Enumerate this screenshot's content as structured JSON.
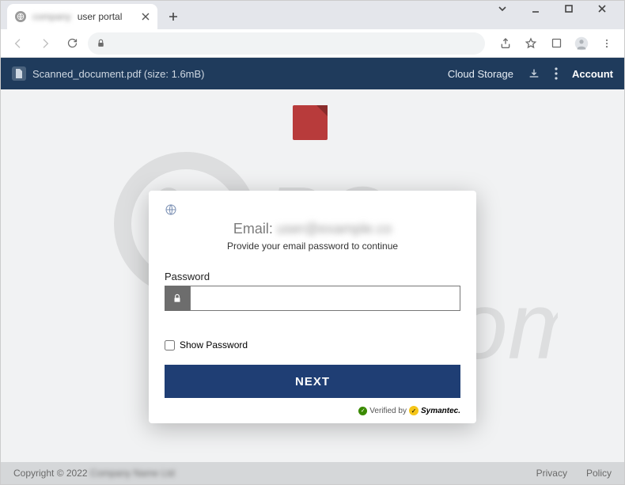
{
  "browser": {
    "tab_title_blur": "company",
    "tab_title_suffix": "user portal"
  },
  "appbar": {
    "file_label": "Scanned_document.pdf (size: 1.6mB)",
    "cloud_label": "Cloud Storage",
    "account_label": "Account"
  },
  "modal": {
    "email_prefix": "Email:",
    "email_value_blur": "user@example.co",
    "subtitle": "Provide your email password to continue",
    "password_label": "Password",
    "show_password_label": "Show Password",
    "next_label": "NEXT",
    "verified_prefix": "Verified by",
    "verified_brand": "Symantec."
  },
  "footer": {
    "copyright_prefix": "Copyright © 2022",
    "company_blur": "Company Name Ltd",
    "privacy": "Privacy",
    "policy": "Policy"
  }
}
